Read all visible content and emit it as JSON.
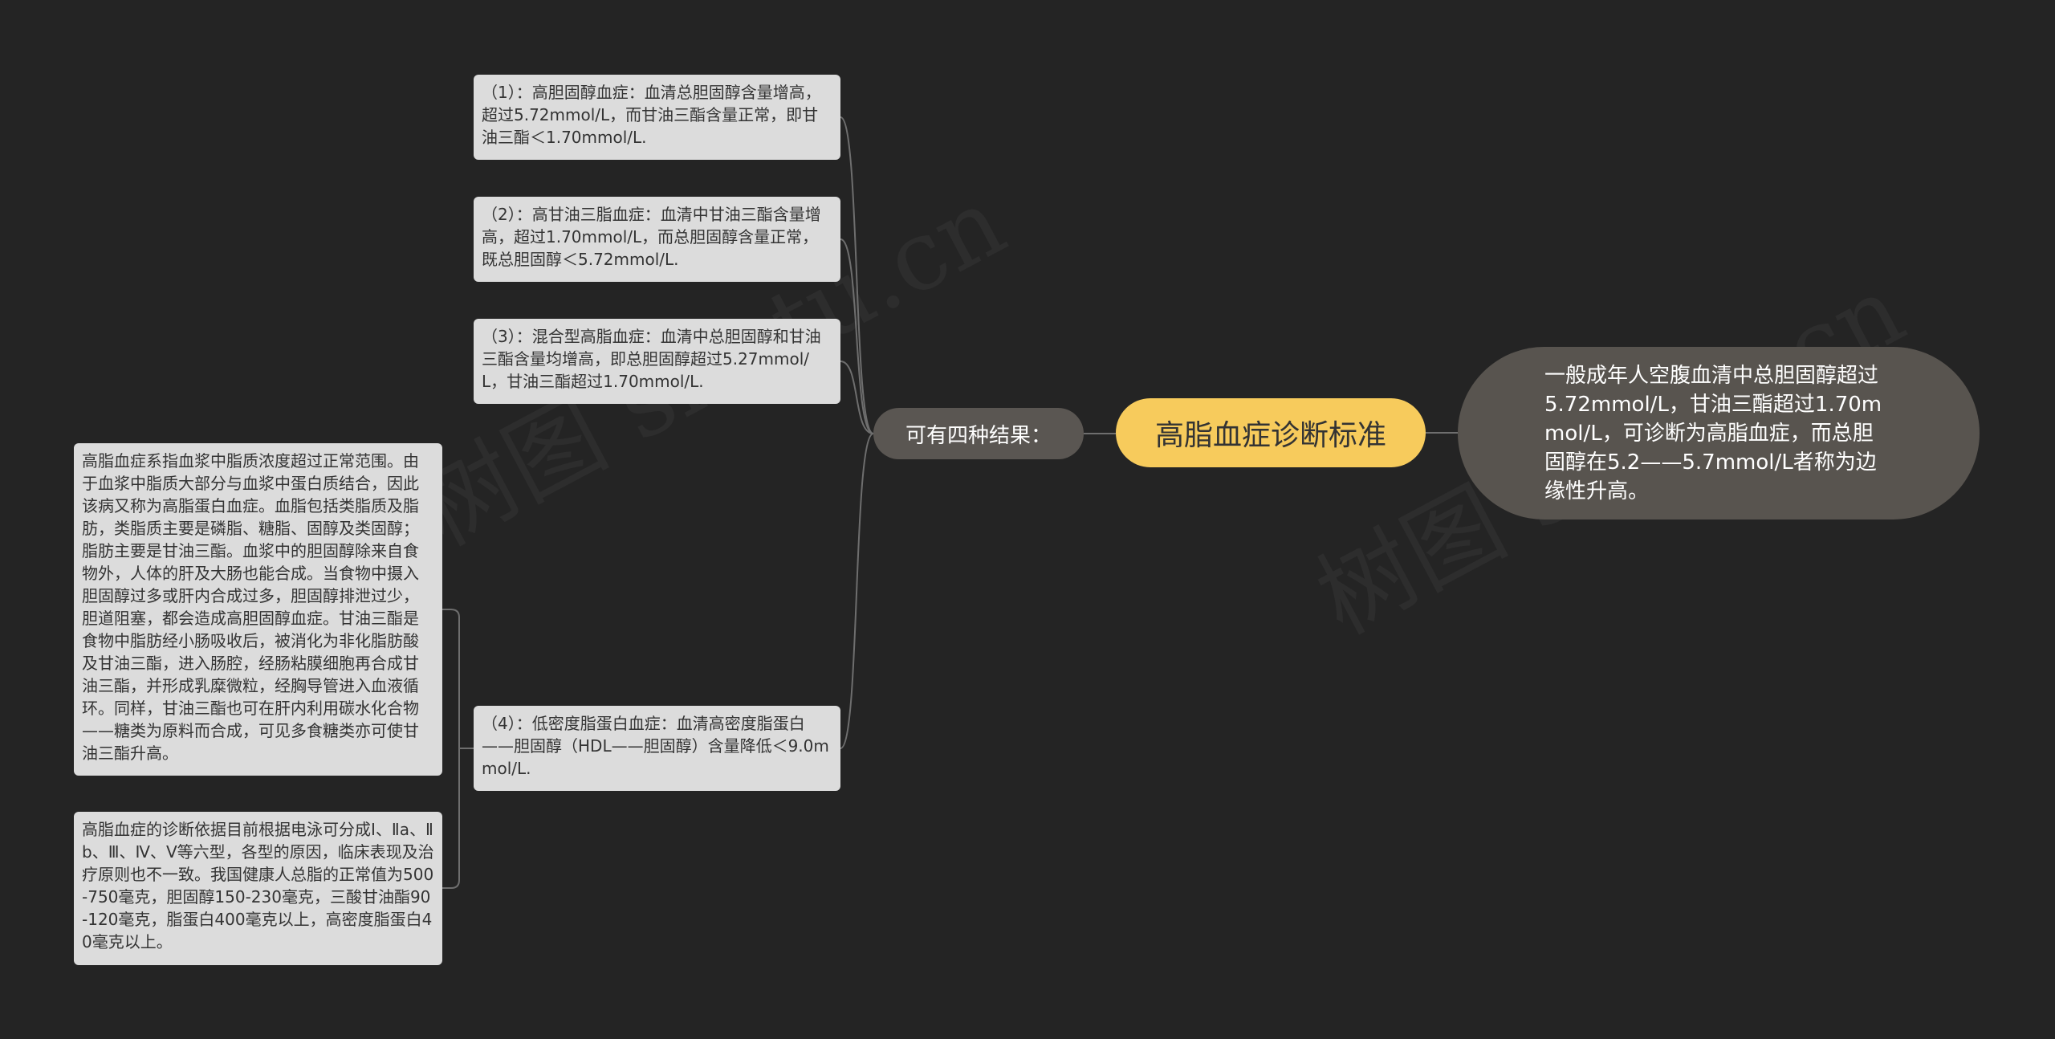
{
  "mindmap": {
    "root": {
      "label": "高脂血症诊断标准"
    },
    "right_node": {
      "text": "一般成年人空腹血清中总胆固醇超过5.72mmol/L，甘油三酯超过1.70mmol/L，可诊断为高脂血症，而总胆固醇在5.2——5.7mmol/L者称为边缘性升高。"
    },
    "branch": {
      "label": "可有四种结果："
    },
    "results": [
      {
        "text": "（1）：高胆固醇血症：血清总胆固醇含量增高，超过5.72mmol/L，而甘油三酯含量正常，即甘油三酯＜1.70mmol/L."
      },
      {
        "text": "（2）：高甘油三脂血症：血清中甘油三酯含量增高，超过1.70mmol/L，而总胆固醇含量正常，既总胆固醇＜5.72mmol/L."
      },
      {
        "text": "（3）：混合型高脂血症：血清中总胆固醇和甘油三酯含量均增高，即总胆固醇超过5.27mmol/L，甘油三酯超过1.70mmol/L."
      },
      {
        "text": "（4）：低密度脂蛋白血症：血清高密度脂蛋白——胆固醇（HDL——胆固醇）含量降低＜9.0mmol/L."
      }
    ],
    "details": [
      {
        "text": "高脂血症系指血浆中脂质浓度超过正常范围。由于血浆中脂质大部分与血浆中蛋白质结合，因此该病又称为高脂蛋白血症。血脂包括类脂质及脂肪，类脂质主要是磷脂、糖脂、固醇及类固醇；脂肪主要是甘油三酯。血浆中的胆固醇除来自食物外，人体的肝及大肠也能合成。当食物中摄入胆固醇过多或肝内合成过多，胆固醇排泄过少，胆道阻塞，都会造成高胆固醇血症。甘油三酯是食物中脂肪经小肠吸收后，被消化为非化脂肪酸及甘油三酯，进入肠腔，经肠粘膜细胞再合成甘油三酯，并形成乳糜微粒，经胸导管进入血液循环。同样，甘油三酯也可在肝内利用碳水化合物——糖类为原料而合成，可见多食糖类亦可使甘油三酯升高。"
      },
      {
        "text": "高脂血症的诊断依据目前根据电泳可分成I、Ⅱa、Ⅱb、Ⅲ、Ⅳ、Ⅴ等六型，各型的原因，临床表现及治疗原则也不一致。我国健康人总脂的正常值为500-750毫克，胆固醇150-230毫克，三酸甘油酯90-120毫克，脂蛋白400毫克以上，高密度脂蛋白40毫克以上。"
      }
    ]
  },
  "colors": {
    "background": "#242424",
    "root_fill": "#f7cb5c",
    "oval_fill": "#58544f",
    "branch_fill": "#5a5652",
    "card_fill": "#dcdcdc",
    "link": "#6e6e6e"
  }
}
